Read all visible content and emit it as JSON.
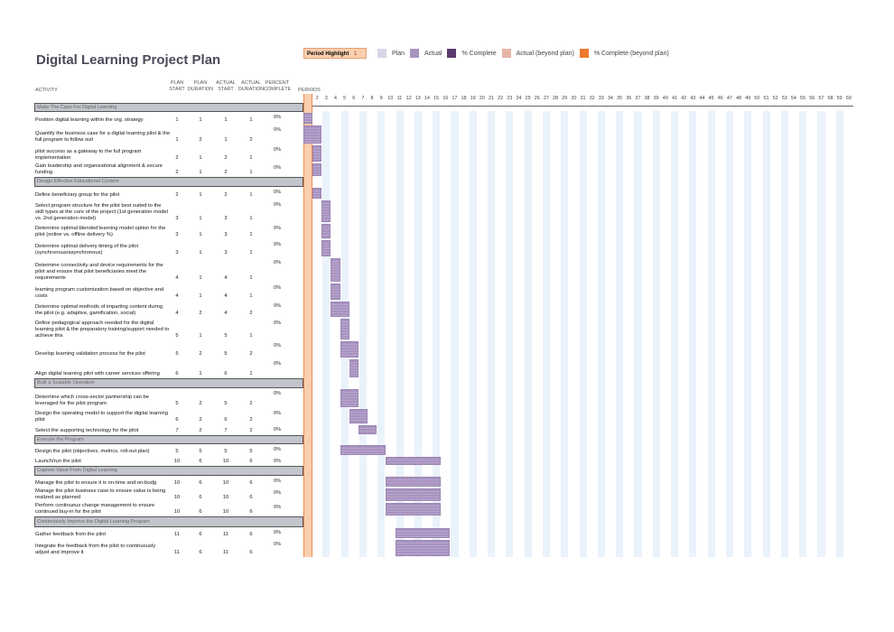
{
  "title": "Digital Learning Project Plan",
  "period_highlight": {
    "label": "Period Highlight",
    "value": "1"
  },
  "legend": [
    {
      "label": "Plan",
      "color": "#d9d4e6"
    },
    {
      "label": "Actual",
      "color": "#a893c0"
    },
    {
      "label": "% Complete",
      "color": "#5a3a6e"
    },
    {
      "label": "Actual (beyond plan)",
      "color": "#e8b4a8"
    },
    {
      "label": "% Complete (beyond plan)",
      "color": "#f07830"
    }
  ],
  "headers": {
    "activity": "ACTIVITY",
    "plan_start": [
      "PLAN",
      "START"
    ],
    "plan_duration": [
      "PLAN",
      "DURATION"
    ],
    "actual_start": [
      "ACTUAL",
      "START"
    ],
    "actual_duration": [
      "ACTUAL",
      "DURATION"
    ],
    "percent_complete": [
      "PERCENT",
      "COMPLETE"
    ],
    "periods": "PERIODS"
  },
  "period_count": 60,
  "colors": {
    "highlight": "#f9cfb0",
    "highlight_border": "#f08a4b",
    "section": "#c2c5cc",
    "actual_bar": "#a893c0",
    "grid_shade": "#eaf2fb"
  },
  "rows": [
    {
      "type": "section",
      "label": "Make The Case For Digital Learning"
    },
    {
      "type": "task",
      "label": "Position digital learning within the org. strategy",
      "plan_start": 1,
      "plan_duration": 1,
      "actual_start": 1,
      "actual_duration": 1,
      "percent": "0%"
    },
    {
      "type": "task",
      "label": "Quantify the business case for  a digital learning pilot & the full program to follow suit",
      "plan_start": 1,
      "plan_duration": 2,
      "actual_start": 1,
      "actual_duration": 2,
      "percent": "0%"
    },
    {
      "type": "task",
      "label": "pilot success as a gateway to the full program implementation",
      "plan_start": 2,
      "plan_duration": 1,
      "actual_start": 2,
      "actual_duration": 1,
      "percent": "0%"
    },
    {
      "type": "task",
      "label": "Gain leadership and organizational alignment & secure funding",
      "plan_start": 2,
      "plan_duration": 1,
      "actual_start": 2,
      "actual_duration": 1,
      "percent": "0%"
    },
    {
      "type": "section",
      "label": "Design Effective Educational Content"
    },
    {
      "type": "task",
      "label": "Define beneficiary group for the pilot",
      "plan_start": 2,
      "plan_duration": 1,
      "actual_start": 2,
      "actual_duration": 1,
      "percent": "0%"
    },
    {
      "type": "task",
      "label": "Select program structure for the pilot best suited to the skill types at the core of the project (1st generation model vs. 2nd generation model)",
      "plan_start": 3,
      "plan_duration": 1,
      "actual_start": 3,
      "actual_duration": 1,
      "percent": "0%"
    },
    {
      "type": "task",
      "label": "Determine optimal blended learning model option for the pilot (online vs. offline delivery %)",
      "plan_start": 3,
      "plan_duration": 1,
      "actual_start": 3,
      "actual_duration": 1,
      "percent": "0%"
    },
    {
      "type": "task",
      "label": "Determine optimal delivery timing of the pilot (synchronous/asynchronous)",
      "plan_start": 3,
      "plan_duration": 1,
      "actual_start": 3,
      "actual_duration": 1,
      "percent": "0%"
    },
    {
      "type": "task",
      "label": "Determine connectivity and device requirements for the pilot and ensure that pilot beneficiaries meet the requirements",
      "plan_start": 4,
      "plan_duration": 1,
      "actual_start": 4,
      "actual_duration": 1,
      "percent": "0%"
    },
    {
      "type": "task",
      "label": "learning program customization based on objective and costs",
      "plan_start": 4,
      "plan_duration": 1,
      "actual_start": 4,
      "actual_duration": 1,
      "percent": "0%"
    },
    {
      "type": "task",
      "label": "Determine optimal methods of imparting content during the pilot (e.g. adaptive, gamification, social)",
      "plan_start": 4,
      "plan_duration": 2,
      "actual_start": 4,
      "actual_duration": 2,
      "percent": "0%"
    },
    {
      "type": "task",
      "label": "Define pedagogical approach needed for the digital learning pilot & the preparatory training/support needed to achieve this",
      "plan_start": 5,
      "plan_duration": 1,
      "actual_start": 5,
      "actual_duration": 1,
      "percent": "0%"
    },
    {
      "type": "task",
      "label": "Develop learning validation process for the pilot",
      "plan_start": 5,
      "plan_duration": 2,
      "actual_start": 5,
      "actual_duration": 2,
      "percent": "0%"
    },
    {
      "type": "task",
      "label": "Align digital learning pilot with career services offering",
      "plan_start": 6,
      "plan_duration": 1,
      "actual_start": 6,
      "actual_duration": 1,
      "percent": "0%"
    },
    {
      "type": "section",
      "label": "Built a Scalable Operation"
    },
    {
      "type": "task",
      "label": "Determine which cross-sector partnership can be leveraged for the pilot program",
      "plan_start": 5,
      "plan_duration": 2,
      "actual_start": 5,
      "actual_duration": 2,
      "percent": "0%"
    },
    {
      "type": "task",
      "label": "Design the operating model to support the digital learning pilot",
      "plan_start": 6,
      "plan_duration": 2,
      "actual_start": 6,
      "actual_duration": 2,
      "percent": "0%"
    },
    {
      "type": "task",
      "label": "Select the supporting technology for the pilot",
      "plan_start": 7,
      "plan_duration": 2,
      "actual_start": 7,
      "actual_duration": 2,
      "percent": "0%"
    },
    {
      "type": "section",
      "label": "Execute the Program"
    },
    {
      "type": "task",
      "label": "Design the pilot (objectives, metrics, roll-out plan)",
      "plan_start": 5,
      "plan_duration": 5,
      "actual_start": 5,
      "actual_duration": 5,
      "percent": "0%"
    },
    {
      "type": "task",
      "label": "Launch/run the pilot",
      "plan_start": 10,
      "plan_duration": 6,
      "actual_start": 10,
      "actual_duration": 6,
      "percent": "0%"
    },
    {
      "type": "section",
      "label": "Capture Value From Digital Learning"
    },
    {
      "type": "task",
      "label": "Manage the pilot to ensure it is on-time and on-budg",
      "plan_start": 10,
      "plan_duration": 6,
      "actual_start": 10,
      "actual_duration": 6,
      "percent": "0%"
    },
    {
      "type": "task",
      "label": "Manage the pilot business case to ensure value is being realized as planned",
      "plan_start": 10,
      "plan_duration": 6,
      "actual_start": 10,
      "actual_duration": 6,
      "percent": "0%"
    },
    {
      "type": "task",
      "label": "Perform continuous change management to ensure continued buy-in for the pilot",
      "plan_start": 10,
      "plan_duration": 6,
      "actual_start": 10,
      "actual_duration": 6,
      "percent": "0%"
    },
    {
      "type": "section",
      "label": "Continuously Improve the Digital Learning Program"
    },
    {
      "type": "task",
      "label": "Gather feedback from the pilot",
      "plan_start": 11,
      "plan_duration": 6,
      "actual_start": 11,
      "actual_duration": 6,
      "percent": "0%"
    },
    {
      "type": "task",
      "label": "Integrate the feedback from the pilot to continuously adjust and improve it",
      "plan_start": 11,
      "plan_duration": 6,
      "actual_start": 11,
      "actual_duration": 6,
      "percent": "0%"
    }
  ]
}
